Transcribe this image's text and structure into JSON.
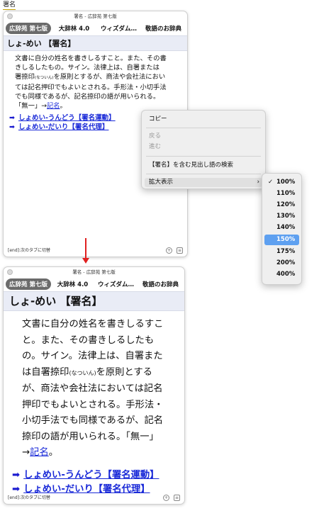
{
  "caption": "署名",
  "window_title": "署名 - 広辞苑 第七版",
  "tabs": [
    "広辞苑 第七版",
    "大辞林 4.0",
    "ウィズダム…",
    "敬語のお辞典"
  ],
  "headword": "しょ-めい 【署名】",
  "definition": {
    "text": "文書に自分の姓名を書きしるすこと。また、その書きしるしたもの。サイン。法律上は、自署または署名捺印",
    "ruby": "(なついん)",
    "text2": "を原則とするが、商法や会社法においては記名押印でもよいとされる。手形法・小切手法でも同様であるが、記名捺印の語が用いられる。「無一」→",
    "link": "記名",
    "end": "。"
  },
  "related": [
    "しょめい-うんどう【署名運動】",
    "しょめい-だいり【署名代理】"
  ],
  "win1_definition_lines": [
    "文書に自分の姓名を書きしるすこと。また、その書",
    "きしるしたもの。サイン。法律上は、自署または",
    [
      "署捺印",
      "(なついん)",
      "を原則とするが、商法や会社法におい"
    ],
    "ては記名押印でもよいとされる。手形法・小切手法",
    "でも同様であるが、記名捺印の語が用いられる。"
  ],
  "win2_definition_lines": [
    "文書に自分の姓名を書きしるすこ",
    "と。また、その書きしるしたも",
    "の。サイン。法律上は、自署また",
    [
      "は自署捺印",
      "(なついん)",
      "を原則とする"
    ],
    "が、商法や会社法においては記名",
    "押印でもよいとされる。手形法・",
    "小切手法でも同様であるが、記名",
    "捺印の語が用いられる。「無一」"
  ],
  "footer_text": "[end]:次のタブに切替",
  "context_menu": {
    "items": [
      "コピー",
      "戻る",
      "進む",
      "【署名】を含む見出し語の検索",
      "拡大表示"
    ],
    "submenu_chevron": "›"
  },
  "zoom_options": [
    "100%",
    "110%",
    "120%",
    "130%",
    "140%",
    "150%",
    "175%",
    "200%",
    "400%"
  ],
  "zoom_checked": "100%",
  "zoom_highlighted": "150%",
  "colors": {
    "link": "#1a2ad8",
    "selection": "#5ea0f0",
    "arrow": "#e02020",
    "headword_bg": "#e9ecf6"
  },
  "icons": [
    "arrow-right-icon",
    "zoom-icon",
    "bookmark-icon",
    "check-icon",
    "chevron-right-icon"
  ]
}
